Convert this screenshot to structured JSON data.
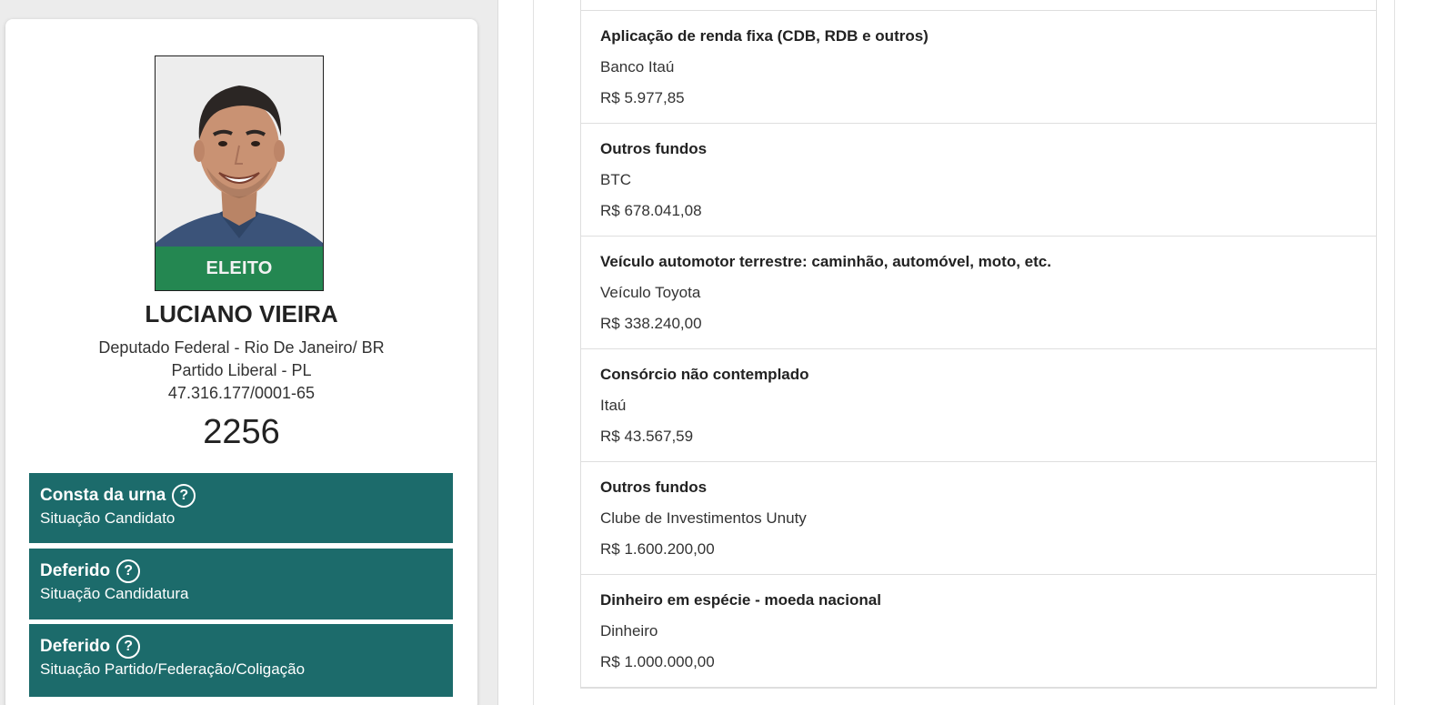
{
  "candidate": {
    "badge": "ELEITO",
    "name": "LUCIANO VIEIRA",
    "office_line": "Deputado Federal - Rio De Janeiro/ BR",
    "party_line": "Partido Liberal - PL",
    "cnpj": "47.316.177/0001-65",
    "number": "2256"
  },
  "status_boxes": [
    {
      "title": "Consta da urna",
      "subtitle": "Situação Candidato",
      "icon": "help-circle-icon"
    },
    {
      "title": "Deferido",
      "subtitle": "Situação Candidatura",
      "icon": "help-circle-icon"
    },
    {
      "title": "Deferido",
      "subtitle": "Situação Partido/Federação/Coligação",
      "icon": "help-circle-icon"
    }
  ],
  "assets": [
    {
      "type": "Aplicação de renda fixa (CDB, RDB e outros)",
      "description": "Banco Itaú",
      "value": "R$ 5.977,85"
    },
    {
      "type": "Outros fundos",
      "description": "BTC",
      "value": "R$ 678.041,08"
    },
    {
      "type": "Veículo automotor terrestre: caminhão, automóvel, moto, etc.",
      "description": "Veículo Toyota",
      "value": "R$ 338.240,00"
    },
    {
      "type": "Consórcio não contemplado",
      "description": "Itaú",
      "value": "R$ 43.567,59"
    },
    {
      "type": "Outros fundos",
      "description": "Clube de Investimentos Unuty",
      "value": "R$ 1.600.200,00"
    },
    {
      "type": "Dinheiro em espécie - moeda nacional",
      "description": "Dinheiro",
      "value": "R$ 1.000.000,00"
    }
  ],
  "colors": {
    "elected_badge": "#228b4f",
    "status_box": "#1c6b6b"
  }
}
